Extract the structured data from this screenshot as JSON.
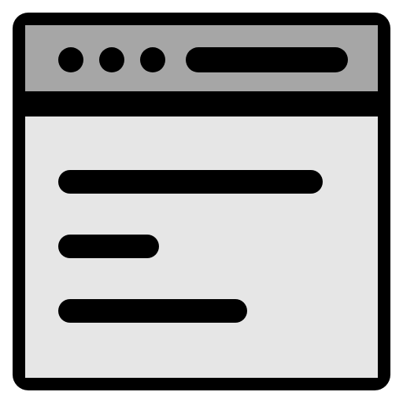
{
  "icon": {
    "name": "browser-window-icon",
    "colors": {
      "outline": "#000000",
      "title_bar": "#a6a6a6",
      "content": "#e6e6e6"
    }
  },
  "title_bar": {
    "dots": [
      {
        "name": "window-dot-1"
      },
      {
        "name": "window-dot-2"
      },
      {
        "name": "window-dot-3"
      }
    ]
  },
  "content": {
    "lines": [
      {
        "name": "content-line-1"
      },
      {
        "name": "content-line-2"
      },
      {
        "name": "content-line-3"
      }
    ]
  }
}
